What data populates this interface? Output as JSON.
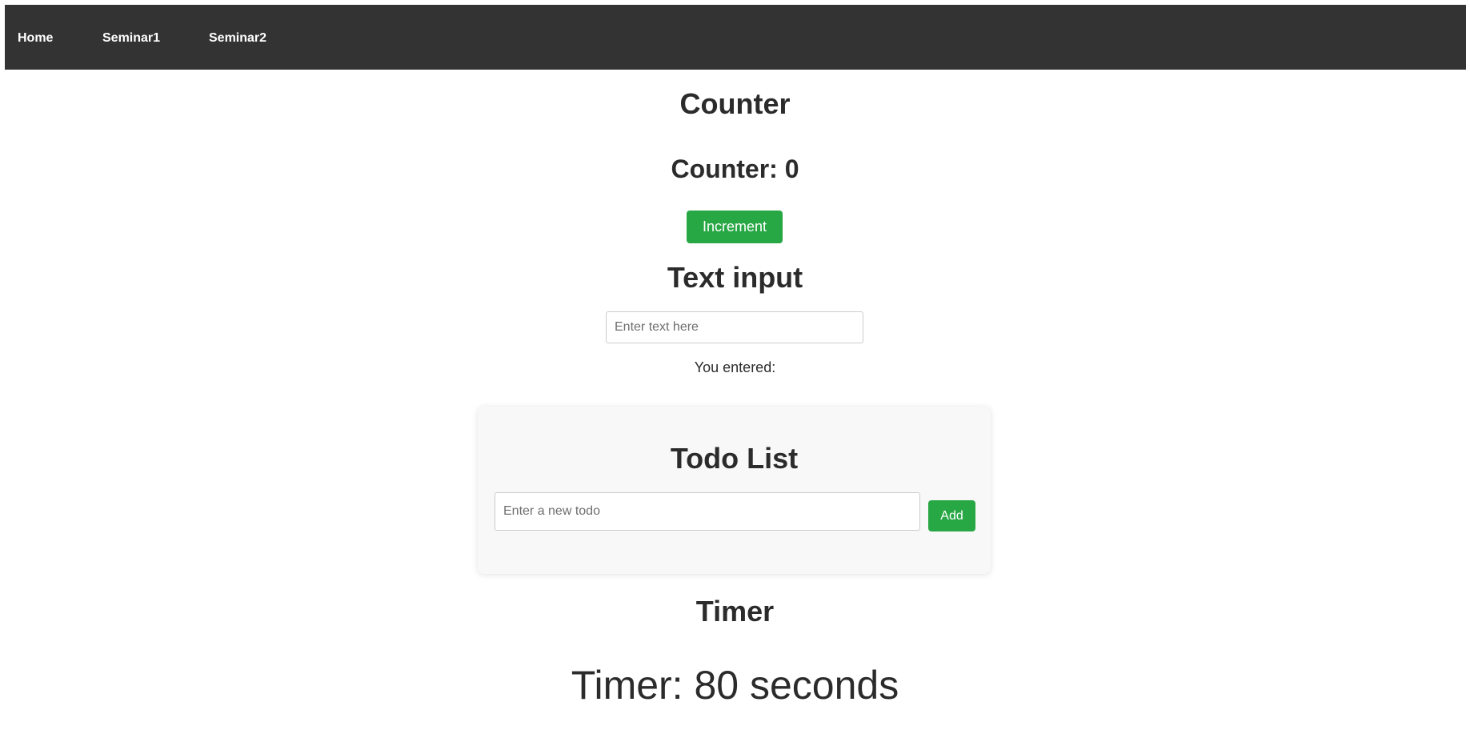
{
  "nav": {
    "home": "Home",
    "seminar1": "Seminar1",
    "seminar2": "Seminar2"
  },
  "counter": {
    "title": "Counter",
    "value_text": "Counter: 0",
    "increment_label": "Increment"
  },
  "text_input": {
    "title": "Text input",
    "placeholder": "Enter text here",
    "value": "",
    "entered_label": "You entered:"
  },
  "todo": {
    "title": "Todo List",
    "placeholder": "Enter a new todo",
    "value": "",
    "add_label": "Add"
  },
  "timer": {
    "title": "Timer",
    "value_text": "Timer: 80 seconds"
  },
  "colors": {
    "navbar": "#333333",
    "accent_green": "#28a745",
    "card_bg": "#f8f8f8"
  }
}
